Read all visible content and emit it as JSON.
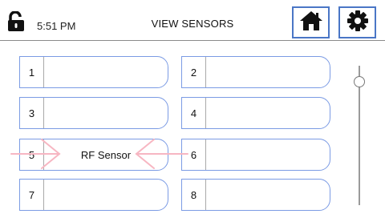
{
  "header": {
    "time": "5:51 PM",
    "title": "VIEW SENSORS"
  },
  "icons": {
    "lock": "unlocked-padlock",
    "home": "home",
    "settings": "gear"
  },
  "colors": {
    "accent": "#4a76c6",
    "slot_border": "#7b9be4",
    "arrow": "#f7b6c2"
  },
  "slots": [
    {
      "number": "1",
      "name": ""
    },
    {
      "number": "2",
      "name": ""
    },
    {
      "number": "3",
      "name": ""
    },
    {
      "number": "4",
      "name": ""
    },
    {
      "number": "5",
      "name": "RF Sensor"
    },
    {
      "number": "6",
      "name": ""
    },
    {
      "number": "7",
      "name": ""
    },
    {
      "number": "8",
      "name": ""
    }
  ]
}
